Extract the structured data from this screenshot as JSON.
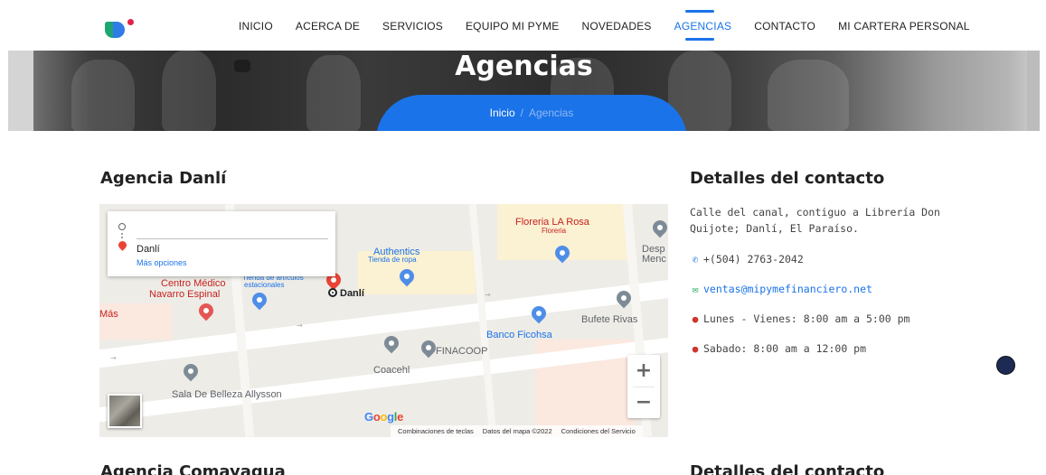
{
  "nav": {
    "items": [
      {
        "label": "INICIO"
      },
      {
        "label": "ACERCA DE"
      },
      {
        "label": "SERVICIOS"
      },
      {
        "label": "EQUIPO MI PYME"
      },
      {
        "label": "NOVEDADES"
      },
      {
        "label": "AGENCIAS",
        "active": true
      },
      {
        "label": "CONTACTO"
      },
      {
        "label": "MI CARTERA PERSONAL"
      }
    ]
  },
  "banner": {
    "title": "Agencias",
    "breadcrumb": {
      "home": "Inicio",
      "separator": "/",
      "current": "Agencias"
    }
  },
  "agency1": {
    "title": "Agencia Danlí",
    "contact_title": "Detalles del contacto",
    "address": "Calle del canal, contiguo a Librería Don Quijote; Danlí, El Paraíso.",
    "phone": "+(504) 2763-2042",
    "email": "ventas@mipymefinanciero.net",
    "hours_weekday": "Lunes - Vienes: 8:00 am a 5:00 pm",
    "hours_saturday": "Sabado: 8:00 am a 12:00 pm"
  },
  "map": {
    "infobox": {
      "destination": "Danlí",
      "more": "Más opciones"
    },
    "labels": {
      "floreria": "Floreria LA Rosa",
      "floreria_sub": "Floreria",
      "authentics": "Authentics",
      "authentics_sub": "Tienda de ropa",
      "desp": "Desp",
      "menc": "Menc",
      "tienda": "Tienda de artículos",
      "tienda2": "estacionales",
      "centro1": "Centro Médico",
      "centro2": "Navarro Espinal",
      "mas": "Más",
      "danli": "Danlí",
      "banco": "Banco Ficohsa",
      "bufete": "Bufete Rivas",
      "finacoop": "FINACOOP",
      "coacehl": "Coacehl",
      "sala": "Sala De Belleza Allysson"
    },
    "google": "Google",
    "attribution": [
      "Combinaciones de teclas",
      "Datos del mapa ©2022",
      "Condiciones del Servicio"
    ],
    "zoom_in": "+",
    "zoom_out": "−"
  },
  "agency2": {
    "title": "Agencia Comayagua",
    "contact_title": "Detalles del contacto"
  },
  "colors": {
    "accent": "#1a73e8",
    "map_bg": "#eeece7"
  }
}
